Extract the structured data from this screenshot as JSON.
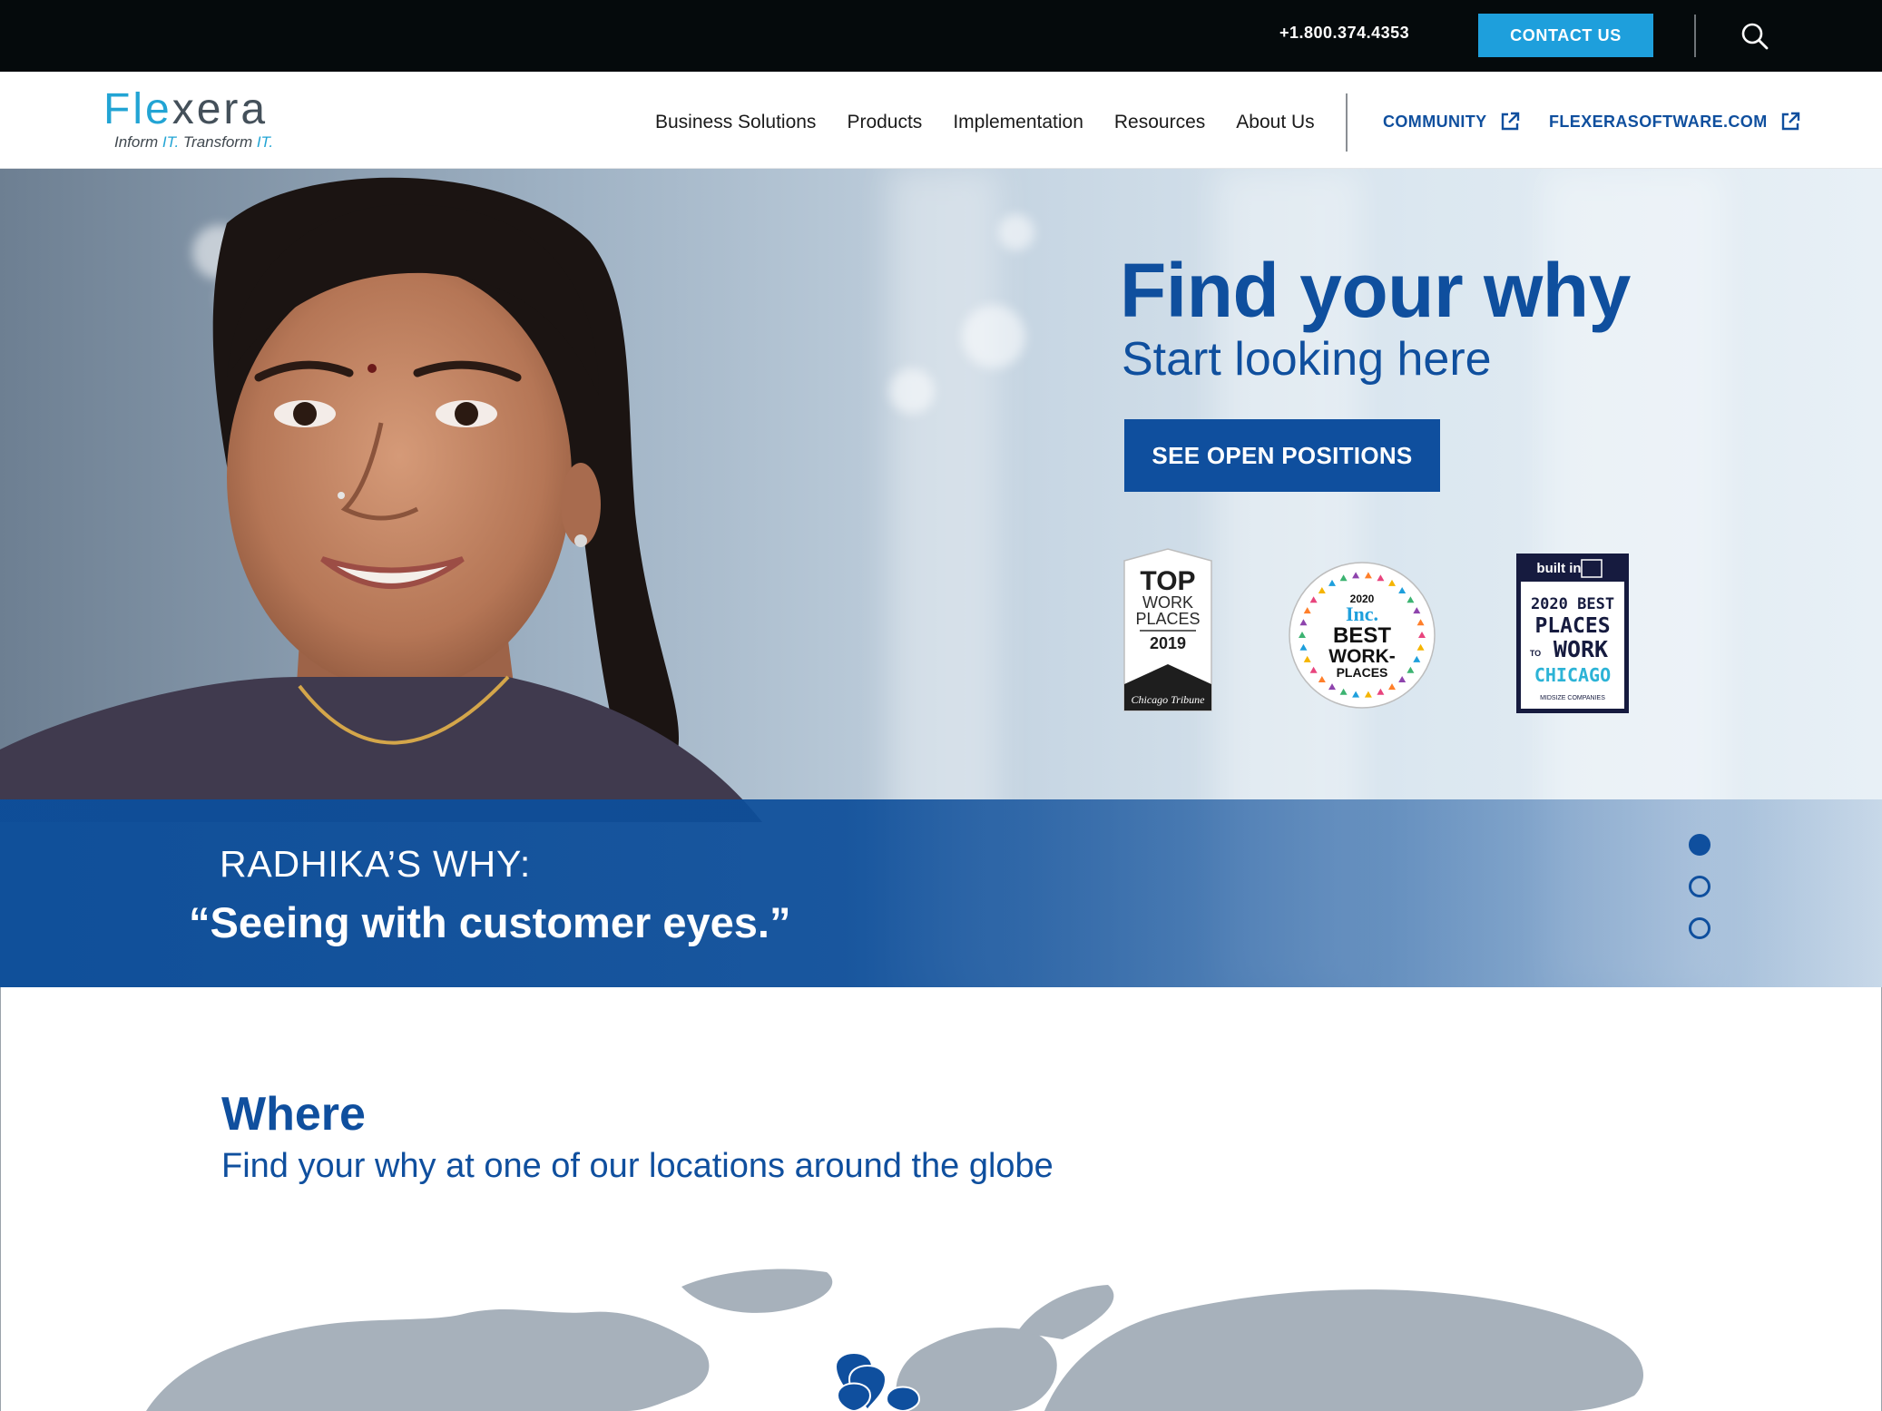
{
  "topbar": {
    "phone": "+1.800.374.4353",
    "contact_label": "CONTACT US",
    "search_icon": "search-icon"
  },
  "logo": {
    "word_part1": "Fle",
    "word_part2": "x",
    "word_part3": "era",
    "tag_a": "Inform ",
    "tag_b": "IT.",
    "tag_c": " Transform ",
    "tag_d": "IT."
  },
  "nav": {
    "items": [
      {
        "label": "Business Solutions"
      },
      {
        "label": "Products"
      },
      {
        "label": "Implementation"
      },
      {
        "label": "Resources"
      },
      {
        "label": "About Us"
      }
    ],
    "external": [
      {
        "label": "COMMUNITY",
        "icon": "external-link-icon"
      },
      {
        "label": "FLEXERASOFTWARE.COM",
        "icon": "external-link-icon"
      }
    ]
  },
  "hero": {
    "title": "Find your why",
    "subtitle": "Start looking here",
    "cta_label": "SEE OPEN POSITIONS",
    "badges": {
      "tribune": {
        "line1": "TOP",
        "line2": "WORK",
        "line3": "PLACES",
        "year": "2019",
        "source": "Chicago Tribune"
      },
      "inc": {
        "year": "2020",
        "brand": "Inc.",
        "line1": "BEST",
        "line2": "WORK-",
        "line3": "PLACES"
      },
      "builtin": {
        "brand": "built in",
        "line1": "2020 BEST",
        "line2": "PLACES",
        "line3_small": "TO",
        "line3": "WORK",
        "line4": "CHICAGO",
        "footer": "MIDSIZE COMPANIES"
      }
    },
    "quote": {
      "name": "RADHIKA’S WHY:",
      "text": "“Seeing with customer eyes.”"
    },
    "carousel": {
      "count": 3,
      "active_index": 0
    }
  },
  "where": {
    "title": "Where",
    "subtitle": "Find your why at one of our locations around the globe"
  },
  "colors": {
    "brand_blue": "#0f4f9e",
    "accent_cyan": "#1e9fdc",
    "topbar_bg": "#050a0c",
    "map_gray": "#a7b1bb"
  }
}
